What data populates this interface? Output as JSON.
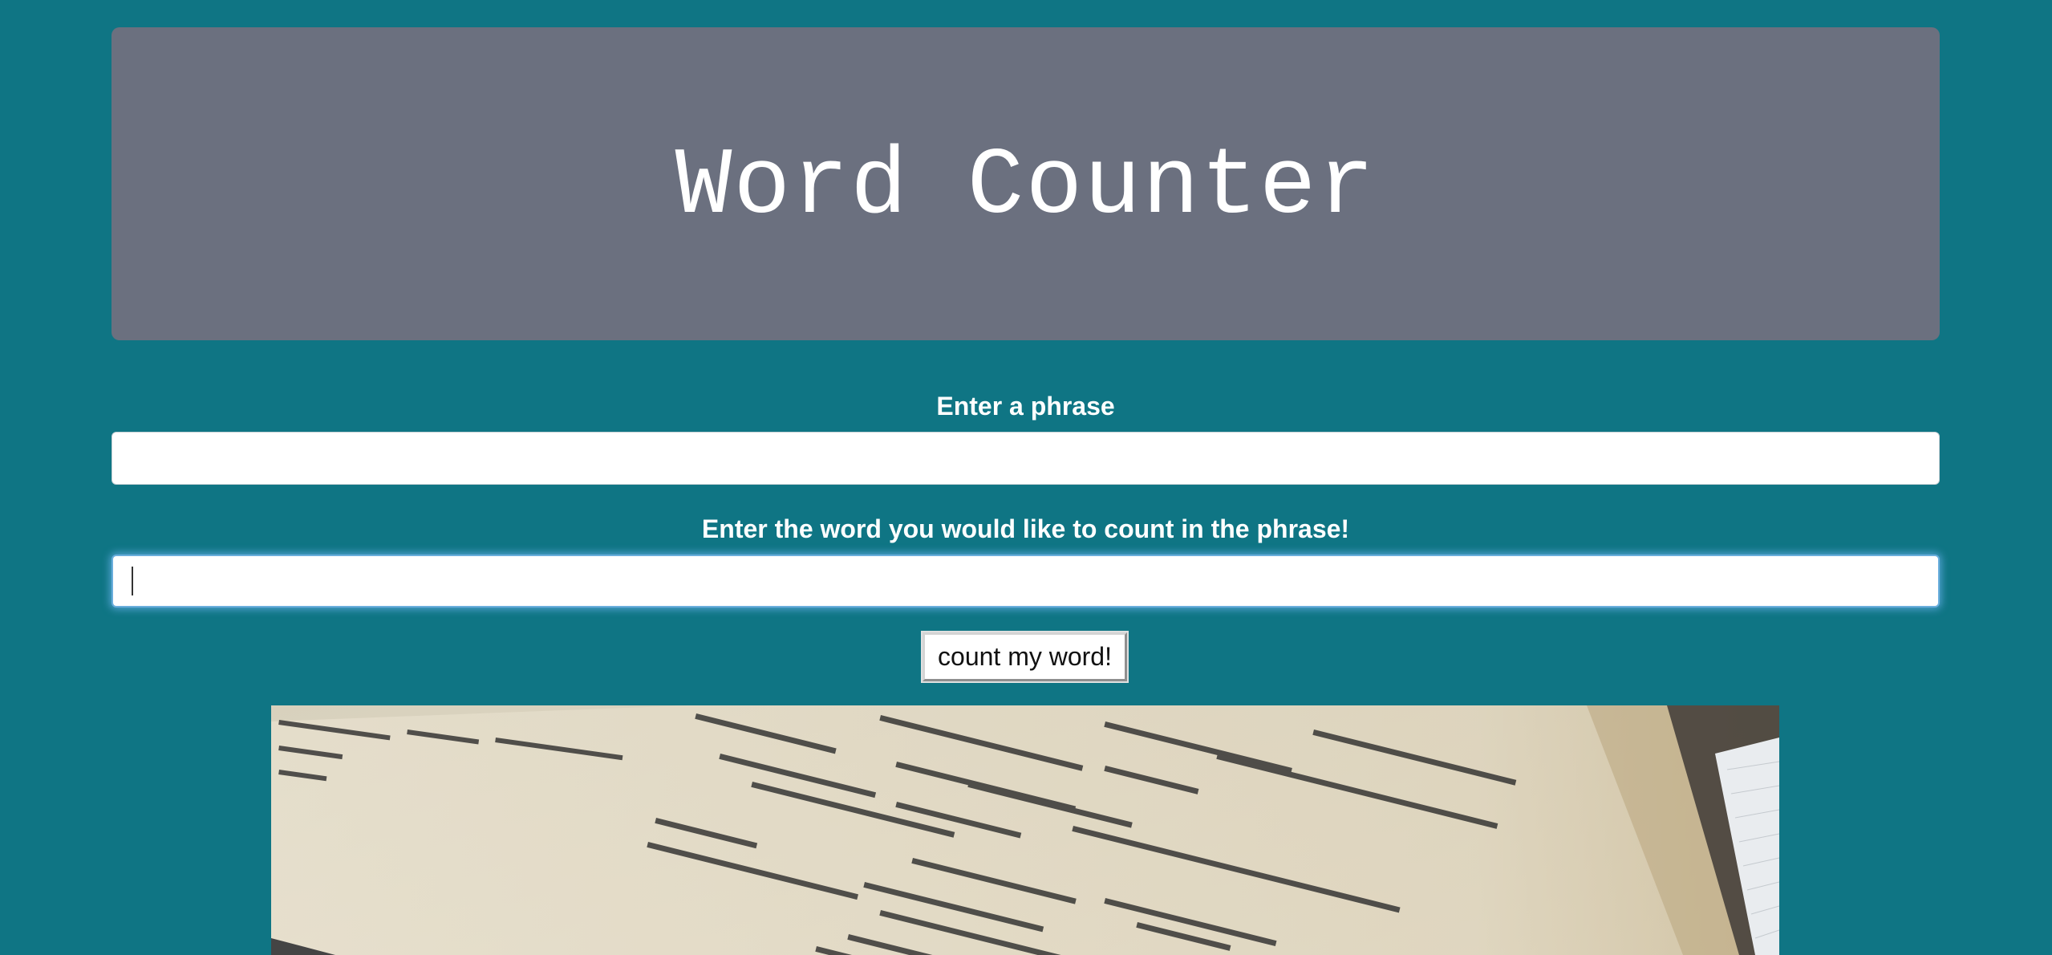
{
  "header": {
    "title": "Word Counter"
  },
  "form": {
    "phrase_label": "Enter a phrase",
    "phrase_value": "",
    "word_label": "Enter the word you would like to count in the phrase!",
    "word_value": "",
    "submit_label": "count my word!"
  },
  "colors": {
    "page_background": "#0f7584",
    "header_background": "#6b707f",
    "focus_glow": "#66afe9"
  },
  "image": {
    "subject": "open math book with logarithm equations"
  }
}
